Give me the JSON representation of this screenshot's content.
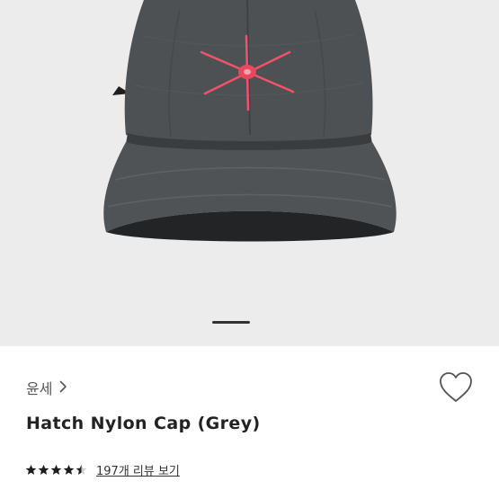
{
  "product": {
    "brand": "윤세",
    "name": "Hatch Nylon Cap (Grey)",
    "rating_stars": 4.5,
    "rating_max": 5,
    "reviews_label": "197개 리뷰 보기"
  },
  "gallery": {
    "current_page_indicator": "active"
  },
  "icons": {
    "brand_chevron": "chevron-right-icon",
    "favorite": "heart-outline-icon",
    "rating": "star-icon"
  },
  "colors": {
    "hero_bg": "#ececec",
    "cap_body": "#4e5153",
    "logo_star": "#f2526a",
    "star_fill": "#1e1e1e",
    "text_primary": "#222222"
  }
}
